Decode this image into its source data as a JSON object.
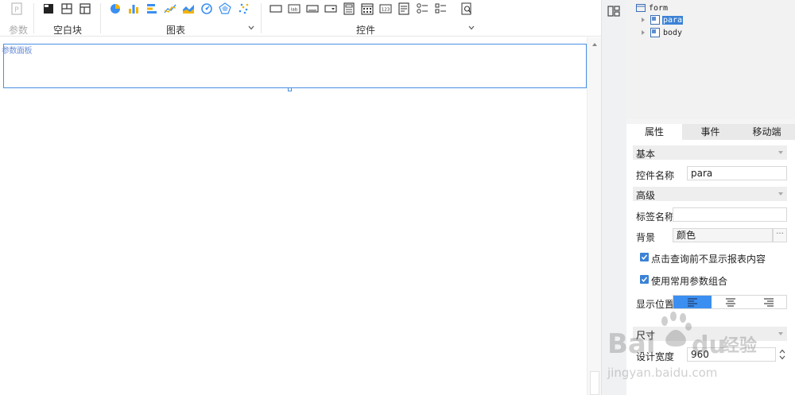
{
  "toolbar": {
    "groups": {
      "params": {
        "label": "参数"
      },
      "blank": {
        "label": "空白块"
      },
      "chart": {
        "label": "图表"
      },
      "widget": {
        "label": "控件"
      }
    }
  },
  "canvas": {
    "para_label": "参数面板"
  },
  "tree": {
    "items": [
      {
        "label": "form"
      },
      {
        "label": "para"
      },
      {
        "label": "body"
      }
    ]
  },
  "tabs": [
    {
      "label": "属性"
    },
    {
      "label": "事件"
    },
    {
      "label": "移动端"
    }
  ],
  "props": {
    "basic": {
      "title": "基本"
    },
    "widget_name": {
      "label": "控件名称",
      "value": "para"
    },
    "advanced": {
      "title": "高级"
    },
    "tag_name": {
      "label": "标签名称",
      "value": ""
    },
    "background": {
      "label": "背景",
      "value": "颜色",
      "button": "···"
    },
    "no_show_before_query": {
      "label": "点击查询前不显示报表内容",
      "checked": true
    },
    "use_common_params": {
      "label": "使用常用参数组合",
      "checked": true
    },
    "display_position": {
      "label": "显示位置",
      "selected": "left"
    },
    "size": {
      "title": "尺寸"
    },
    "design_width": {
      "label": "设计宽度",
      "value": "960"
    }
  },
  "colors": {
    "accent": "#3b82d6",
    "selection_border": "#4a90e2"
  },
  "watermark": {
    "brand": "Bai du 经验",
    "url": "jingyan.baidu.com"
  }
}
